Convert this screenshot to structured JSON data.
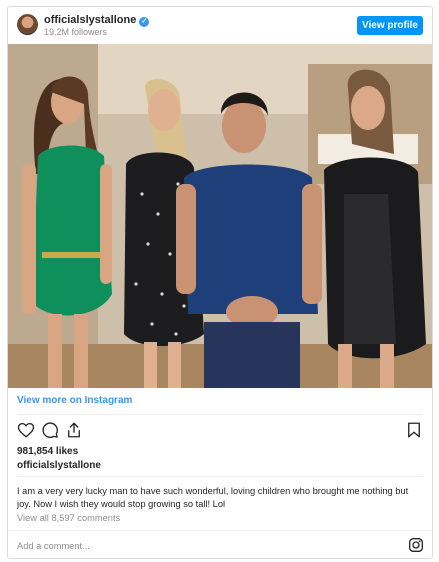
{
  "header": {
    "username": "officialslystallone",
    "followers": "19.2M followers",
    "view_profile_label": "View profile"
  },
  "post": {
    "view_more_label": "View more on Instagram",
    "likes": "981,854 likes",
    "owner": "officialslystallone",
    "caption": "I am a very very lucky man to have such wonderful, loving children who brought me nothing but joy. Now I wish they would stop growing so tall! Lol",
    "comments_link": "View all 8,597 comments"
  },
  "comment_box": {
    "placeholder": "Add a comment..."
  },
  "colors": {
    "accent": "#3897f0",
    "button": "#0095f6",
    "muted": "#8e8e8e"
  },
  "icons": [
    "heart-icon",
    "comment-icon",
    "share-icon",
    "bookmark-icon",
    "instagram-icon",
    "verified-icon"
  ]
}
